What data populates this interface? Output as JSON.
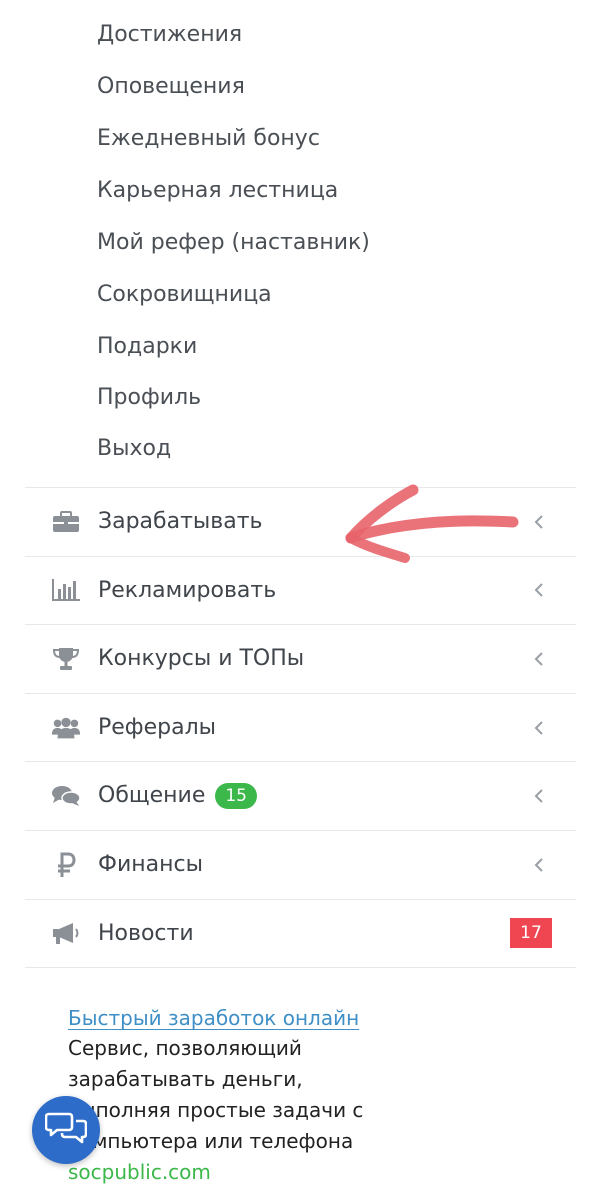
{
  "submenu": {
    "items": [
      "Достижения",
      "Оповещения",
      "Ежедневный бонус",
      "Карьерная лестница",
      "Мой рефер (наставник)",
      "Сокровищница",
      "Подарки",
      "Профиль",
      "Выход"
    ]
  },
  "menu": {
    "items": [
      {
        "label": "Зарабатывать",
        "icon": "briefcase-icon"
      },
      {
        "label": "Рекламировать",
        "icon": "bar-chart-icon"
      },
      {
        "label": "Конкурсы и ТОПы",
        "icon": "trophy-icon"
      },
      {
        "label": "Рефералы",
        "icon": "users-icon"
      },
      {
        "label": "Общение",
        "icon": "comments-icon",
        "badge": "15"
      },
      {
        "label": "Финансы",
        "icon": "ruble-icon"
      },
      {
        "label": "Новости",
        "icon": "megaphone-icon",
        "badge": "17"
      }
    ]
  },
  "promo": {
    "link": "Быстрый заработок онлайн",
    "text": "Сервис, позволяющий зарабатывать деньги, выполняя простые задачи с компьютера или телефона",
    "url": "socpublic.com"
  },
  "colors": {
    "accent_green": "#3cb84a",
    "badge_red": "#ef4652",
    "link_blue": "#3f8fc7",
    "fab_blue": "#2d6cc9",
    "annotation_red": "#e8646c"
  }
}
